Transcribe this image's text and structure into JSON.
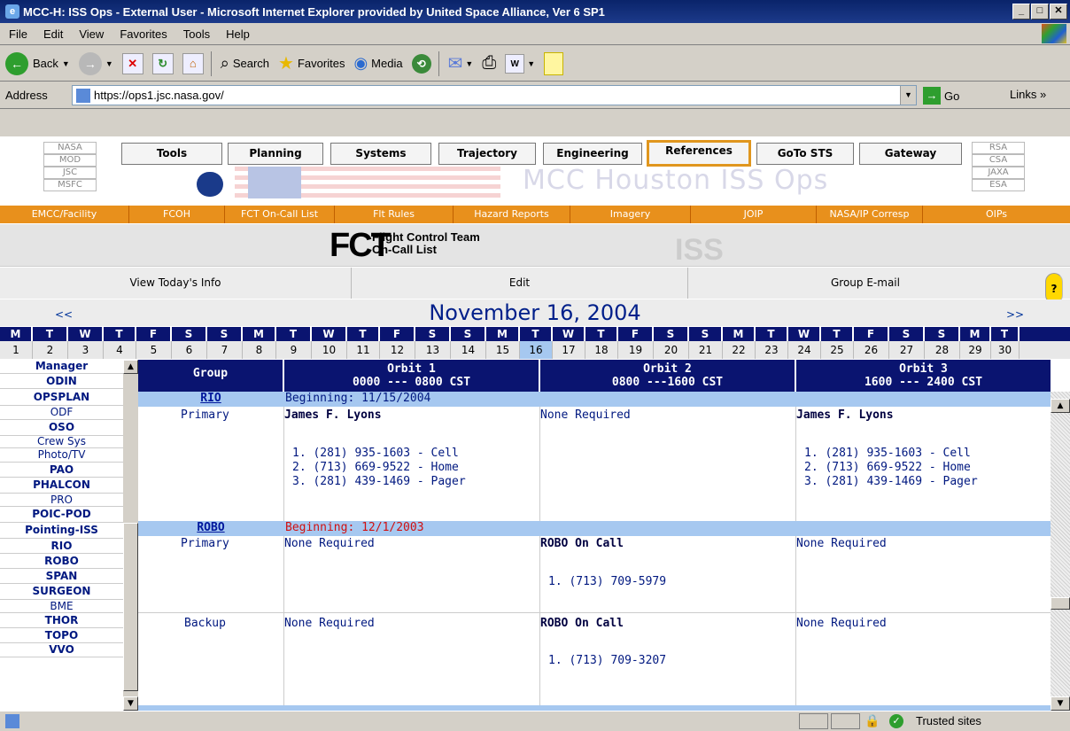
{
  "window": {
    "title": "MCC-H: ISS Ops - External User - Microsoft Internet Explorer provided by United Space Alliance, Ver 6 SP1"
  },
  "menu": [
    "File",
    "Edit",
    "View",
    "Favorites",
    "Tools",
    "Help"
  ],
  "toolbar": {
    "back": "Back",
    "search": "Search",
    "favorites": "Favorites",
    "media": "Media"
  },
  "address": {
    "label": "Address",
    "url": "https://ops1.jsc.nasa.gov/",
    "go": "Go",
    "links": "Links"
  },
  "header": {
    "left_tags": [
      "NASA",
      "MOD",
      "JSC",
      "MSFC"
    ],
    "right_tags": [
      "RSA",
      "CSA",
      "JAXA",
      "ESA"
    ],
    "nav": [
      "Tools",
      "Planning",
      "Systems",
      "Trajectory",
      "Engineering",
      "References",
      "GoTo STS",
      "Gateway"
    ],
    "selected_nav": "References",
    "banner": "MCC Houston    ISS Ops"
  },
  "subnav": [
    "EMCC/Facility",
    "FCOH",
    "FCT On-Call List",
    "Flt Rules",
    "Hazard Reports",
    "Imagery",
    "JOIP",
    "NASA/IP Corresp",
    "OIPs"
  ],
  "page": {
    "fct": "FCT",
    "fct_line1": "Flight Control Team",
    "fct_line2": "On-Call List",
    "iss": "ISS",
    "actions": [
      "View Today's Info",
      "Edit",
      "Group E-mail"
    ],
    "help": "?",
    "prev": "<<",
    "next": ">>",
    "month": "November 16, 2004"
  },
  "calendar": {
    "days": [
      "M",
      "T",
      "W",
      "T",
      "F",
      "S",
      "S",
      "M",
      "T",
      "W",
      "T",
      "F",
      "S",
      "S",
      "M",
      "T",
      "W",
      "T",
      "F",
      "S",
      "S",
      "M",
      "T",
      "W",
      "T",
      "F",
      "S",
      "S",
      "M",
      "T"
    ],
    "dates": [
      "1",
      "2",
      "3",
      "4",
      "5",
      "6",
      "7",
      "8",
      "9",
      "10",
      "11",
      "12",
      "13",
      "14",
      "15",
      "16",
      "17",
      "18",
      "19",
      "20",
      "21",
      "22",
      "23",
      "24",
      "25",
      "26",
      "27",
      "28",
      "29",
      "30"
    ],
    "today": "16"
  },
  "groups_list": [
    "Manager",
    "ODIN",
    "OPSPLAN",
    "ODF",
    "OSO",
    "Crew Sys",
    "Photo/TV",
    "PAO",
    "PHALCON",
    "PRO",
    "POIC-POD",
    "Pointing-ISS",
    "RIO",
    "ROBO",
    "SPAN",
    "SURGEON",
    "BME",
    "THOR",
    "TOPO",
    "VVO"
  ],
  "table": {
    "headers": {
      "group": "Group",
      "orbit1": "Orbit 1",
      "orbit1_time": "0000 --- 0800 CST",
      "orbit2": "Orbit 2",
      "orbit2_time": "0800 ---1600 CST",
      "orbit3": "Orbit 3",
      "orbit3_time": "1600 --- 2400 CST"
    },
    "rio": {
      "name": "RIO",
      "beginning": "Beginning: 11/15/2004",
      "role": "Primary",
      "o1_name": "James F. Lyons",
      "o1_p1": "1.  (281) 935-1603 - Cell",
      "o1_p2": "2.  (713) 669-9522 - Home",
      "o1_p3": "3.  (281) 439-1469 - Pager",
      "o2": "None Required",
      "o3_name": "James F. Lyons",
      "o3_p1": "1.  (281) 935-1603 - Cell",
      "o3_p2": "2.  (713) 669-9522 - Home",
      "o3_p3": "3.  (281) 439-1469 - Pager"
    },
    "robo": {
      "name": "ROBO",
      "beginning": "Beginning: 12/1/2003",
      "primary_role": "Primary",
      "primary_o1": "None Required",
      "primary_o2_name": "ROBO On Call",
      "primary_o2_p1": "1.  (713) 709-5979",
      "primary_o3": "None Required",
      "backup_role": "Backup",
      "backup_o1": "None Required",
      "backup_o2_name": "ROBO On Call",
      "backup_o2_p1": "1.  (713) 709-3207",
      "backup_o3": "None Required"
    }
  },
  "status": {
    "zone": "Trusted sites"
  }
}
